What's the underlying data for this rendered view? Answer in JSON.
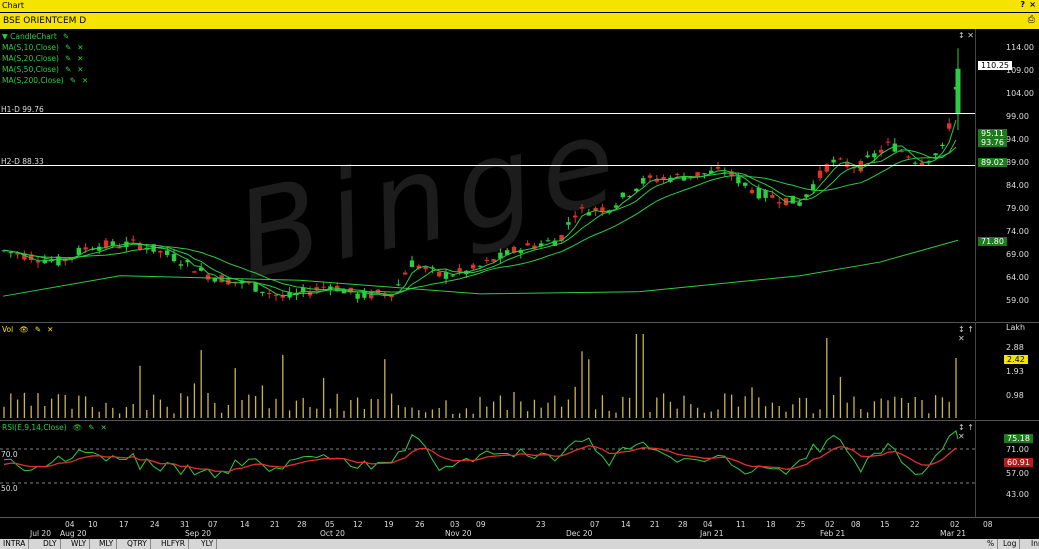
{
  "window": {
    "title": "Chart",
    "help_icon": "help-icon",
    "close_icon": "close-icon"
  },
  "symbol": {
    "label": "BSE ORIENTCEM D"
  },
  "price_pane": {
    "legend": [
      "CandleChart",
      "MA(S,10,Close)",
      "MA(S,20,Close)",
      "MA(S,50,Close)",
      "MA(S,200,Close)"
    ],
    "hlines": [
      {
        "label": "H1-D 99.76",
        "value": 99.76
      },
      {
        "label": "H2-D 88.33",
        "value": 88.33
      }
    ],
    "ticks": [
      "114.00",
      "109.00",
      "104.00",
      "99.00",
      "94.00",
      "89.00",
      "84.00",
      "79.00",
      "74.00",
      "69.00",
      "64.00",
      "59.00"
    ],
    "badges": [
      {
        "text": "110.25",
        "color": "#ffffff",
        "fg": "#000000"
      },
      {
        "text": "95.11",
        "color": "#1f7a1f"
      },
      {
        "text": "93.76",
        "color": "#1f7a1f"
      },
      {
        "text": "89.02",
        "color": "#1f7a1f"
      },
      {
        "text": "71.80",
        "color": "#1f7a1f"
      }
    ],
    "watermark": "Binge"
  },
  "vol_pane": {
    "label": "Vol",
    "unit": "Lakh",
    "ticks": [
      "2.88",
      "1.93",
      "0.98"
    ],
    "badge": "2.42"
  },
  "rsi_pane": {
    "label": "RSI(E,9,14,Close)",
    "level_hi": "70.0",
    "level_lo": "50.0",
    "ticks": [
      "71.00",
      "57.00",
      "43.00"
    ],
    "badges": [
      "75.18",
      "60.91"
    ]
  },
  "xaxis": {
    "labels": [
      "04",
      "10",
      "17",
      "24",
      "31",
      "07",
      "14",
      "21",
      "28",
      "05",
      "12",
      "19",
      "26",
      "03",
      "09",
      "23",
      "07",
      "14",
      "21",
      "28",
      "04",
      "11",
      "18",
      "25",
      "02",
      "08",
      "15",
      "22",
      "02",
      "08"
    ],
    "months": [
      "Jul 20",
      "Aug 20",
      "Sep 20",
      "Oct 20",
      "Nov 20",
      "Dec 20",
      "Jan 21",
      "Feb 21",
      "Mar 21"
    ]
  },
  "tabs": [
    "INTRA",
    "DLY",
    "WLY",
    "MLY",
    "QTRY",
    "HLFYR",
    "YLY"
  ],
  "right_tabs": [
    "%",
    "Log",
    "Inr"
  ],
  "colors": {
    "up": "#2ecc40",
    "down": "#e0322b",
    "ma": "#2ecc40",
    "vol": "#c9b64a",
    "rsi": "#2ecc40",
    "rsi_signal": "#e0322b",
    "accent": "#f5e400"
  }
}
